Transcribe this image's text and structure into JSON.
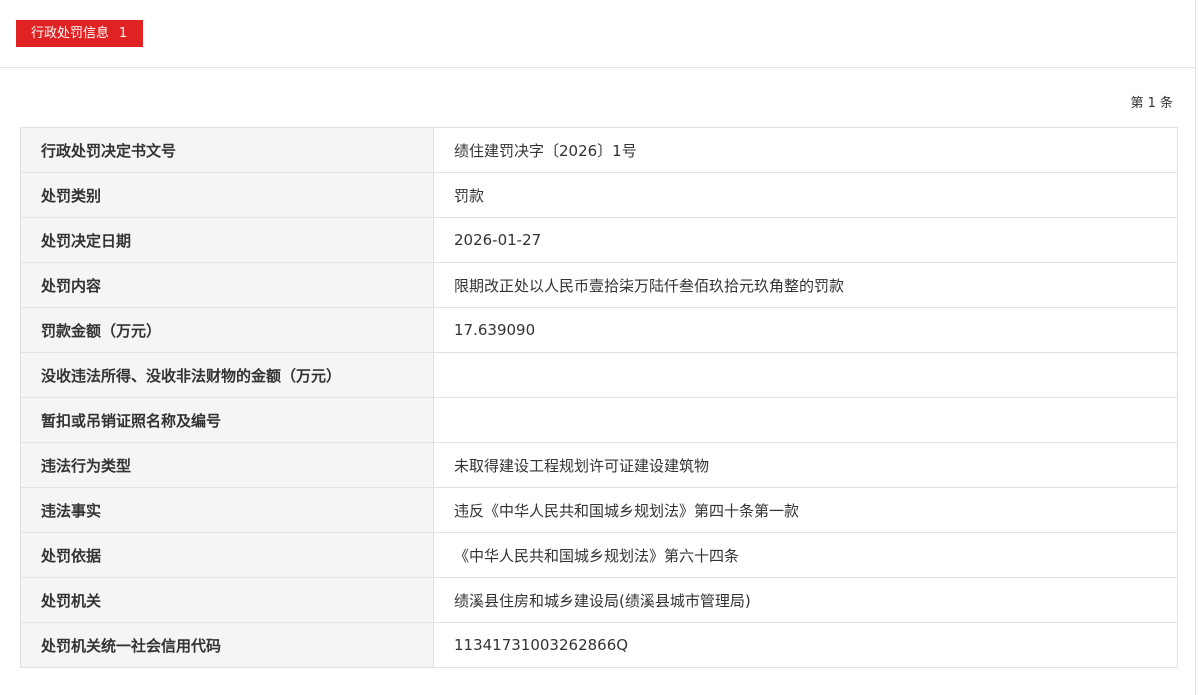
{
  "tab": {
    "label": "行政处罚信息",
    "count": "1"
  },
  "record_count": "第 1 条",
  "rows": [
    {
      "label": "行政处罚决定书文号",
      "value": "绩住建罚决字〔2026〕1号"
    },
    {
      "label": "处罚类别",
      "value": "罚款"
    },
    {
      "label": "处罚决定日期",
      "value": "2026-01-27"
    },
    {
      "label": "处罚内容",
      "value": "限期改正处以人民币壹拾柒万陆仟叁佰玖拾元玖角整的罚款"
    },
    {
      "label": "罚款金额（万元）",
      "value": "17.639090"
    },
    {
      "label": "没收违法所得、没收非法财物的金额（万元）",
      "value": ""
    },
    {
      "label": "暂扣或吊销证照名称及编号",
      "value": ""
    },
    {
      "label": "违法行为类型",
      "value": "未取得建设工程规划许可证建设建筑物"
    },
    {
      "label": "违法事实",
      "value": "违反《中华人民共和国城乡规划法》第四十条第一款"
    },
    {
      "label": "处罚依据",
      "value": "《中华人民共和国城乡规划法》第六十四条"
    },
    {
      "label": "处罚机关",
      "value": "绩溪县住房和城乡建设局(绩溪县城市管理局)"
    },
    {
      "label": "处罚机关统一社会信用代码",
      "value": "11341731003262866Q"
    }
  ],
  "colors": {
    "tab_background": "#e02222",
    "label_background": "#f5f5f5",
    "border": "#e2e2e2"
  }
}
